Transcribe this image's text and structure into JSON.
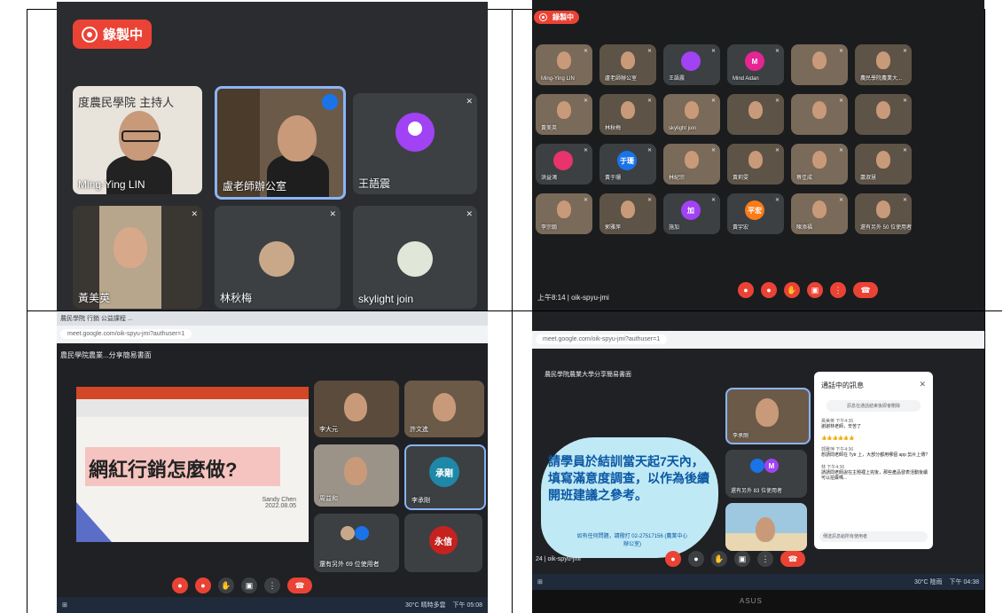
{
  "panel1": {
    "recording_label": "錄製中",
    "tiles": [
      {
        "name": "Ming-Ying LIN",
        "bg_text": "度農民學院 主持人"
      },
      {
        "name": "盧老師辦公室"
      },
      {
        "name": "王語震",
        "avatar_color": "#a142f4"
      },
      {
        "name": "黃美英"
      },
      {
        "name": "林秋梅"
      },
      {
        "name": "skylight join"
      }
    ]
  },
  "panel2": {
    "recording_label": "錄製中",
    "meeting_time": "上午8:14",
    "meeting_code": "oik-spyu-jmi",
    "tiles": [
      {
        "name": "Ming-Ying LIN"
      },
      {
        "name": "盧老師辦公室"
      },
      {
        "name": "王語震",
        "letter": "",
        "color": "#a142f4"
      },
      {
        "name": "Mind Aidan",
        "letter": "M",
        "color": "#e52592"
      },
      {
        "name": ""
      },
      {
        "name": "農民學院農業大..."
      },
      {
        "name": "黃美英"
      },
      {
        "name": "林秋梅"
      },
      {
        "name": "skylight join"
      },
      {
        "name": ""
      },
      {
        "name": ""
      },
      {
        "name": ""
      },
      {
        "name": "洪益鴻",
        "color": "#e8336d"
      },
      {
        "name": "黃于珊",
        "letter": "于珊",
        "color": "#1a73e8"
      },
      {
        "name": "林紀宗"
      },
      {
        "name": "黃莉雯"
      },
      {
        "name": "蔡佳成"
      },
      {
        "name": "蕭淑慧"
      },
      {
        "name": "李宗翰"
      },
      {
        "name": "郭雅萍"
      },
      {
        "name": "施加",
        "letter": "加",
        "color": "#a142f4"
      },
      {
        "name": "黃宇宏",
        "letter": "平宏",
        "color": "#fa7b17"
      },
      {
        "name": "陳添福"
      },
      {
        "name": "還有另外 50 位使用者"
      }
    ]
  },
  "panel3": {
    "tab_label": "農民學院 行銷 公益課程 ...",
    "address": "meet.google.com/oik-spyu-jmi?authuser=1",
    "meeting_name": "農民學院農業...分享簡易書面",
    "slide_title": "網紅行銷怎麼做?",
    "slide_author": "Sandy Chen",
    "slide_date": "2022.08.05",
    "tiles": [
      {
        "name": "李大元"
      },
      {
        "name": "許文進"
      },
      {
        "name": "周益和"
      },
      {
        "name": "李承剛",
        "letter": "承剛",
        "color": "#1e88a8"
      },
      {
        "name": "還有另外 69 位使用者"
      },
      {
        "name": "永信",
        "letter": "永信",
        "color": "#c5221f"
      }
    ],
    "weather": "30°C 晴時多雲",
    "clock": "下午 05:08"
  },
  "panel4": {
    "address": "meet.google.com/oik-spyu-jmi?authuser=1",
    "meeting_name": "農民學院農業大學分享簡易書面",
    "slide_text": "請學員於結訓當天起7天內，填寫滿意度調查，以作為後續開班建議之參考。",
    "slide_note": "如有任何問題，請撥打 02-27517156 (農業中心辦公室)",
    "chat_title": "通話中的訊息",
    "chat_notice": "訊息在通話結束後即會刪除",
    "chat_messages": [
      {
        "sender": "黃美英 下午4:35",
        "text": "謝謝林老師，辛苦了"
      },
      {
        "sender": "",
        "text": "👍👍👍👍👍👍"
      },
      {
        "sender": "郭雅萍 下午4:36",
        "text": "想請問老師在 Tytr 上，大部分都用哪個 app 剪片上傳?"
      },
      {
        "sender": "林 下午4:36",
        "text": "請請問老師說在主題裡上完後，那些產品發表活動後續可以拍賣嗎..."
      }
    ],
    "chat_input": "傳送訊息給所有使用者",
    "tiles": [
      {
        "name": "李承剛"
      },
      {
        "name": "還有另外 83 位使用者"
      },
      {
        "name": ""
      }
    ],
    "meeting_code": "oik-spyu-jmi",
    "time_prefix": "24",
    "weather": "30°C 陰雨",
    "clock": "下午 04:38",
    "monitor_brand": "ASUS"
  }
}
